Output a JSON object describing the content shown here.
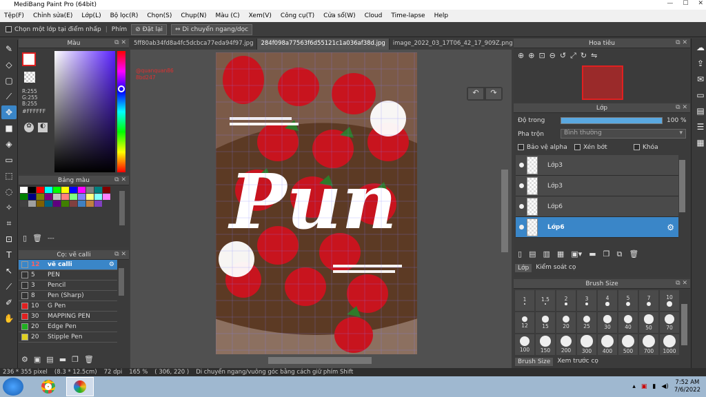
{
  "window": {
    "title": "MediBang Paint Pro (64bit)"
  },
  "menu": [
    "Tệp(F)",
    "Chỉnh sửa(E)",
    "Lớp(L)",
    "Bộ lọc(R)",
    "Chọn(S)",
    "Chụp(N)",
    "Màu (C)",
    "Xem(V)",
    "Công cụ(T)",
    "Cửa sổ(W)",
    "Cloud",
    "Time-lapse",
    "Help"
  ],
  "options": {
    "select_layer": "Chọn một lớp tại điểm nhấp",
    "key_label": "Phím",
    "reset": "Đặt lại",
    "move_mode": "Di chuyển ngang/dọc"
  },
  "color_panel": {
    "title": "Màu",
    "r": "R:255",
    "g": "G:255",
    "b": "B:255",
    "hex": "#FFFFFF"
  },
  "swatch_panel": {
    "title": "Bảng màu",
    "extra": "---"
  },
  "brush_panel": {
    "title": "Cọ: vẽ calli",
    "items": [
      {
        "size": "12",
        "name": "vẽ calli",
        "color": "#3a86c8",
        "selected": true
      },
      {
        "size": "5",
        "name": "PEN",
        "color": "#333333"
      },
      {
        "size": "3",
        "name": "Pencil",
        "color": "#333333"
      },
      {
        "size": "8",
        "name": "Pen (Sharp)",
        "color": "#333333"
      },
      {
        "size": "10",
        "name": "G Pen",
        "color": "#e02020"
      },
      {
        "size": "30",
        "name": "MAPPING PEN",
        "color": "#e02020"
      },
      {
        "size": "20",
        "name": "Edge Pen",
        "color": "#20b020"
      },
      {
        "size": "20",
        "name": "Stipple Pen",
        "color": "#e0d020"
      }
    ]
  },
  "tabs": [
    "5ff80ab34fd8a4fc5dcbca77eda94f97.jpg",
    "284f098a77563f6d55121c1a036af38d.jpg",
    "image_2022_03_17T06_42_17_909Z.png"
  ],
  "canvas": {
    "watermark_line1": "@quanquan86",
    "watermark_line2": "8bd247",
    "art_text": "Pun"
  },
  "navigator": {
    "title": "Hoa tiêu"
  },
  "layer_panel": {
    "title": "Lớp",
    "opacity_label": "Độ trong",
    "opacity_value": "100 %",
    "opacity": 100,
    "blend_label": "Pha trộn",
    "blend_value": "Bình thường",
    "protect_alpha": "Bảo vệ alpha",
    "clipping": "Xén bớt",
    "lock": "Khóa",
    "layers": [
      {
        "name": "Lớp3",
        "selected": false
      },
      {
        "name": "Lớp3",
        "selected": false
      },
      {
        "name": "Lớp6",
        "selected": false
      },
      {
        "name": "Lớp6",
        "selected": true
      }
    ],
    "tab_layer": "Lớp",
    "tab_control": "Kiểm soát cọ"
  },
  "brush_size_panel": {
    "title": "Brush Size",
    "sizes": [
      "1",
      "1.5",
      "2",
      "3",
      "4",
      "5",
      "7",
      "10",
      "12",
      "15",
      "20",
      "25",
      "30",
      "40",
      "50",
      "70",
      "100",
      "150",
      "200",
      "300",
      "400",
      "500",
      "700",
      "1000"
    ],
    "tab_size": "Brush Size",
    "tab_preview": "Xem trước cọ"
  },
  "status": {
    "dims": "236 * 355 pixel",
    "cm": "(8.3 * 12.5cm)",
    "dpi": "72 dpi",
    "zoom": "165 %",
    "coords": "( 306, 220 )",
    "hint": "Di chuyển ngang/vuông góc bằng cách giữ phím Shift"
  },
  "taskbar": {
    "time": "7:52 AM",
    "date": "7/6/2022"
  }
}
